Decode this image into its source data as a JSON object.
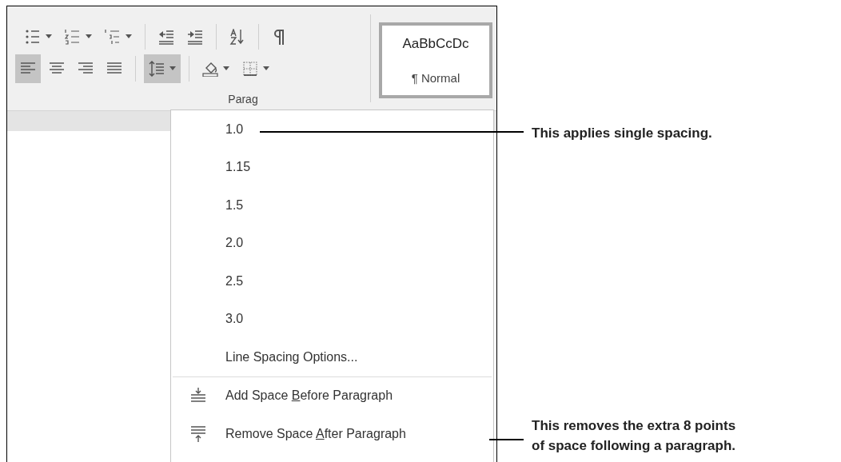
{
  "ribbon": {
    "row_1": [
      {
        "kind": "bullets",
        "dropdown": true
      },
      {
        "kind": "numbering",
        "dropdown": true
      },
      {
        "kind": "multilevel",
        "dropdown": true
      },
      {
        "kind": "separator"
      },
      {
        "kind": "outdent",
        "dropdown": false
      },
      {
        "kind": "indent",
        "dropdown": false
      },
      {
        "kind": "separator"
      },
      {
        "kind": "sort",
        "dropdown": false
      },
      {
        "kind": "separator"
      },
      {
        "kind": "pilcrow",
        "dropdown": false
      }
    ],
    "row_2": [
      {
        "kind": "align-left",
        "dropdown": false,
        "selected": true
      },
      {
        "kind": "align-center",
        "dropdown": false,
        "selected": false
      },
      {
        "kind": "align-right",
        "dropdown": false,
        "selected": false
      },
      {
        "kind": "justify",
        "dropdown": false,
        "selected": false
      },
      {
        "kind": "separator"
      },
      {
        "kind": "line-spacing",
        "dropdown": true,
        "selected": true
      },
      {
        "kind": "separator"
      },
      {
        "kind": "shading",
        "dropdown": true,
        "selected": false
      },
      {
        "kind": "borders",
        "dropdown": true,
        "selected": false
      }
    ],
    "group_label": "Parag",
    "style": {
      "preview": "AaBbCcDc",
      "name": "¶ Normal"
    }
  },
  "menu": {
    "items": [
      {
        "kind": "option",
        "label": [
          "1.0"
        ]
      },
      {
        "kind": "option",
        "label": [
          "1.15"
        ]
      },
      {
        "kind": "option",
        "label": [
          "1.5"
        ]
      },
      {
        "kind": "option",
        "label": [
          "2.0"
        ]
      },
      {
        "kind": "option",
        "label": [
          "2.5"
        ]
      },
      {
        "kind": "option",
        "label": [
          "3.0"
        ]
      },
      {
        "kind": "option",
        "label": [
          "Line Spacing Options..."
        ]
      },
      {
        "kind": "separator"
      },
      {
        "kind": "add-before",
        "label": [
          "Add Space ",
          "B",
          "efore Paragraph"
        ]
      },
      {
        "kind": "remove-after",
        "label": [
          "Remove Space ",
          "A",
          "fter Paragraph"
        ]
      }
    ]
  },
  "callouts": [
    {
      "lines": [
        "This applies single spacing."
      ]
    },
    {
      "lines": [
        "This removes the extra 8 points",
        "of space following a paragraph."
      ]
    }
  ]
}
